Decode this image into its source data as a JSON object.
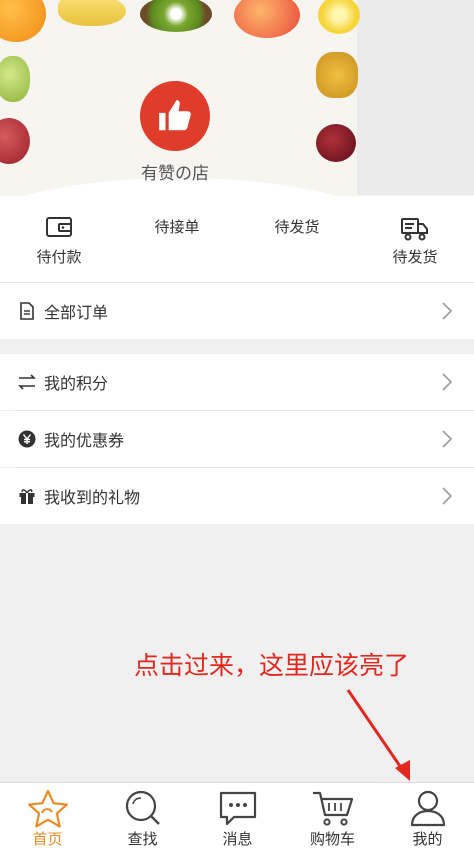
{
  "shop": {
    "name": "有赞の店"
  },
  "orders": {
    "items": [
      {
        "label": "待付款",
        "icon": "wallet-icon"
      },
      {
        "label": "待接单",
        "icon": ""
      },
      {
        "label": "待发货",
        "icon": ""
      },
      {
        "label": "待发货",
        "icon": "truck-icon"
      }
    ],
    "all_orders": "全部订单"
  },
  "menu": [
    {
      "label": "我的积分",
      "icon": "exchange-icon"
    },
    {
      "label": "我的优惠券",
      "icon": "yen-coin-icon"
    },
    {
      "label": "我收到的礼物",
      "icon": "gift-icon"
    }
  ],
  "annotation": {
    "text": "点击过来，这里应该亮了"
  },
  "tabbar": {
    "tabs": [
      {
        "label": "首页",
        "icon": "star-icon",
        "active": true
      },
      {
        "label": "查找",
        "icon": "search-icon",
        "active": false
      },
      {
        "label": "消息",
        "icon": "message-icon",
        "active": false
      },
      {
        "label": "购物车",
        "icon": "cart-icon",
        "active": false
      },
      {
        "label": "我的",
        "icon": "user-icon",
        "active": false
      }
    ]
  },
  "colors": {
    "accent": "#e98c28",
    "logo_red": "#e03c2b",
    "annotation_red": "#e2281e"
  }
}
